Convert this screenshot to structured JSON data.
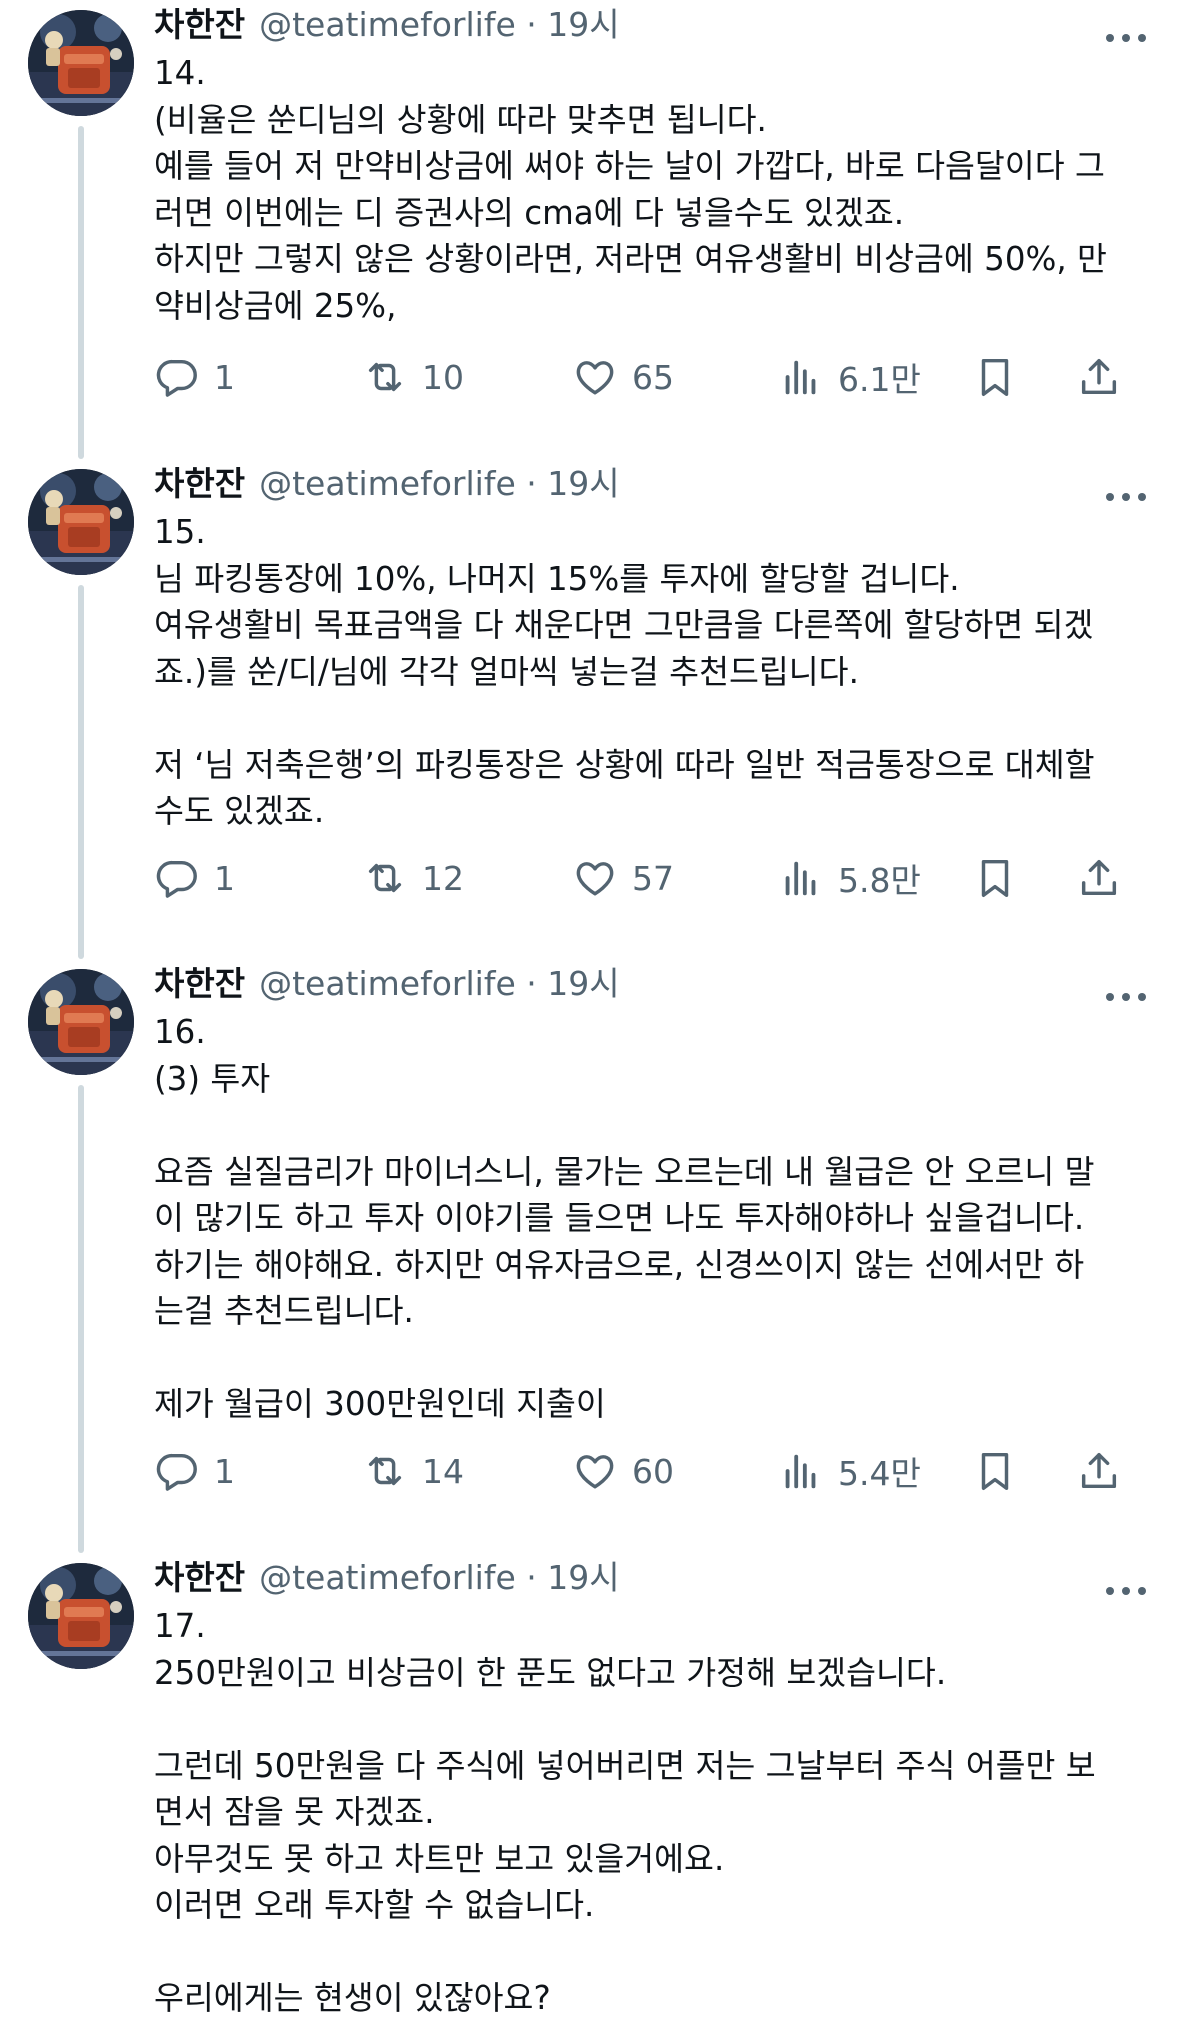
{
  "tweets": [
    {
      "name": "차한잔",
      "handle": "@teatimeforlife",
      "sep": " · ",
      "time": "19시",
      "body": "14.\n(비율은 쑨디님의 상황에 따라 맞추면 됩니다.\n예를 들어 저 만약비상금에 써야 하는 날이 가깝다, 바로 다음달이다 그\n러면 이번에는 디 증권사의 cma에 다 넣을수도 있겠죠.\n하지만 그렇지 않은 상황이라면, 저라면 여유생활비 비상금에 50%, 만\n약비상금에 25%,",
      "replies": "1",
      "retweets": "10",
      "likes": "65",
      "views": "6.1만"
    },
    {
      "name": "차한잔",
      "handle": "@teatimeforlife",
      "sep": " · ",
      "time": "19시",
      "body": "15.\n님 파킹통장에 10%, 나머지 15%를 투자에 할당할 겁니다.\n여유생활비 목표금액을 다 채운다면 그만큼을 다른쪽에 할당하면 되겠\n죠.)를 쑨/디/님에 각각 얼마씩 넣는걸 추천드립니다.\n\n저 ‘님 저축은행’의 파킹통장은 상황에 따라 일반 적금통장으로 대체할\n수도 있겠죠.",
      "replies": "1",
      "retweets": "12",
      "likes": "57",
      "views": "5.8만"
    },
    {
      "name": "차한잔",
      "handle": "@teatimeforlife",
      "sep": " · ",
      "time": "19시",
      "body": "16.\n(3) 투자\n\n요즘 실질금리가 마이너스니, 물가는 오르는데 내 월급은 안 오르니 말\n이 많기도 하고 투자 이야기를 들으면 나도 투자해야하나 싶을겁니다.\n하기는 해야해요. 하지만 여유자금으로, 신경쓰이지 않는 선에서만 하\n는걸 추천드립니다.\n\n제가 월급이 300만원인데 지출이",
      "replies": "1",
      "retweets": "14",
      "likes": "60",
      "views": "5.4만"
    },
    {
      "name": "차한잔",
      "handle": "@teatimeforlife",
      "sep": " · ",
      "time": "19시",
      "body": "17.\n250만원이고 비상금이 한 푼도 없다고 가정해 보겠습니다.\n\n그런데 50만원을 다 주식에 넣어버리면 저는 그날부터 주식 어플만 보\n면서 잠을 못 자겠죠.\n아무것도 못 하고 차트만 보고 있을거에요.\n이러면 오래 투자할 수 없습니다.\n\n우리에게는 현생이 있잖아요?"
    }
  ],
  "icons": {
    "reply": "reply-icon",
    "retweet": "retweet-icon",
    "like": "like-icon",
    "views": "views-icon",
    "bookmark": "bookmark-icon",
    "share": "share-icon",
    "more": "more-icon"
  },
  "colors": {
    "text": "#0f1419",
    "secondary": "#536471",
    "thread_line": "#cfd9de"
  }
}
